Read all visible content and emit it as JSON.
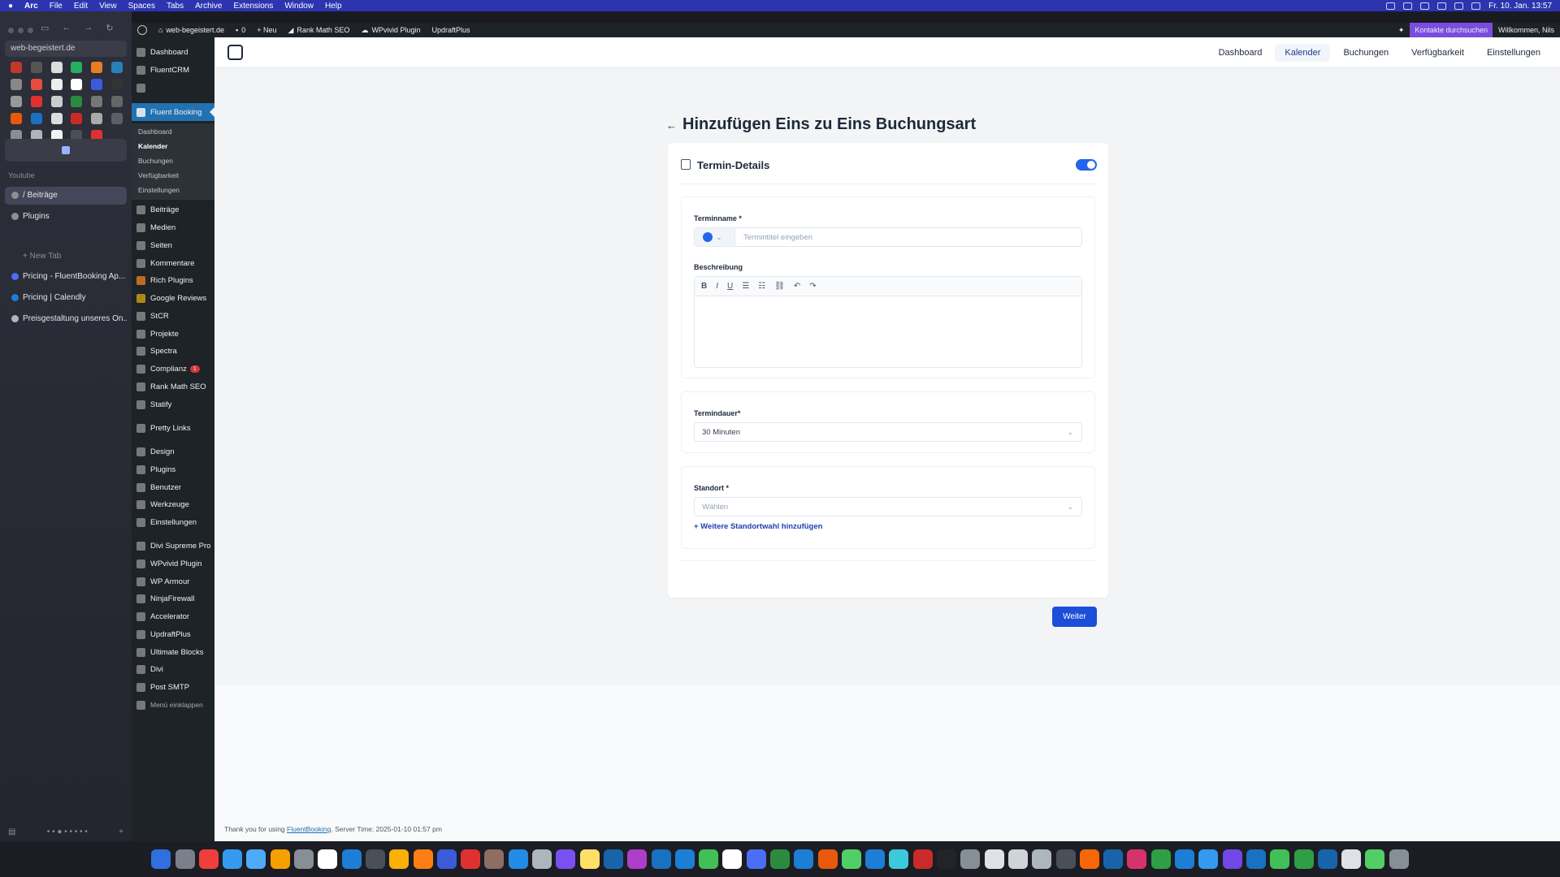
{
  "mac_menu": {
    "apple": "",
    "app": "Arc",
    "items": [
      "File",
      "Edit",
      "View",
      "Spaces",
      "Tabs",
      "Archive",
      "Extensions",
      "Window",
      "Help"
    ],
    "clock": "Fr. 10. Jan. 13:57"
  },
  "arc": {
    "url": "web-begeistert.de",
    "section_youtube": "Youtube",
    "tabs": [
      {
        "label": "/ Beiträge"
      },
      {
        "label": "Plugins"
      }
    ],
    "new_tab": "+ New Tab",
    "other_tabs": [
      {
        "label": "Pricing - FluentBooking Ap..."
      },
      {
        "label": "Pricing | Calendly"
      },
      {
        "label": "Preisgestaltung unseres On..."
      }
    ]
  },
  "wp_bar": {
    "site": "web-begeistert.de",
    "comments": "0",
    "new": "+ Neu",
    "rankmath": "Rank Math SEO",
    "wpvivid": "WPvivid Plugin",
    "updraft": "UpdraftPlus",
    "contact": "Kontakte durchsuchen",
    "welcome": "Willkommen, Nils"
  },
  "wp_menu": {
    "top": [
      "Dashboard",
      "FluentCRM"
    ],
    "active": "Fluent Booking",
    "sub": [
      "Dashboard",
      "Kalender",
      "Buchungen",
      "Verfügbarkeit",
      "Einstellungen"
    ],
    "items": [
      "Beiträge",
      "Medien",
      "Seiten",
      "Kommentare",
      "Rich Plugins",
      "Google Reviews",
      "StCR",
      "Projekte",
      "Spectra",
      "Complianz",
      "Rank Math SEO",
      "Statify",
      "Pretty Links",
      "Design",
      "Plugins",
      "Benutzer",
      "Werkzeuge",
      "Einstellungen",
      "Divi Supreme Pro",
      "WPvivid Plugin",
      "WP Armour",
      "NinjaFirewall",
      "Accelerator",
      "UpdraftPlus",
      "Ultimate Blocks",
      "Divi",
      "Post SMTP",
      "Menü einklappen"
    ],
    "complianz_badge": "1"
  },
  "fb_nav": {
    "items": [
      "Dashboard",
      "Kalender",
      "Buchungen",
      "Verfügbarkeit",
      "Einstellungen"
    ],
    "active": "Kalender"
  },
  "page": {
    "back": "←",
    "title": "Hinzufügen Eins zu Eins Buchungsart",
    "card_title": "Termin-Details",
    "name_label": "Terminname *",
    "name_placeholder": "Termintitel eingeben",
    "desc_label": "Beschreibung",
    "duration_label": "Termindauer*",
    "duration_value": "30 Minuten",
    "location_label": "Standort *",
    "location_placeholder": "Wählen",
    "add_location": "+ Weitere Standortwahl hinzufügen",
    "next": "Weiter"
  },
  "footer": {
    "thanks": "Thank you for using ",
    "link": "FluentBooking",
    "server": ". Server Time: 2025-01-10 01:57 pm"
  },
  "colors": {
    "wp_active": "#2271b1",
    "primary": "#1d4ed8",
    "admin_bar": "#1d2327"
  }
}
